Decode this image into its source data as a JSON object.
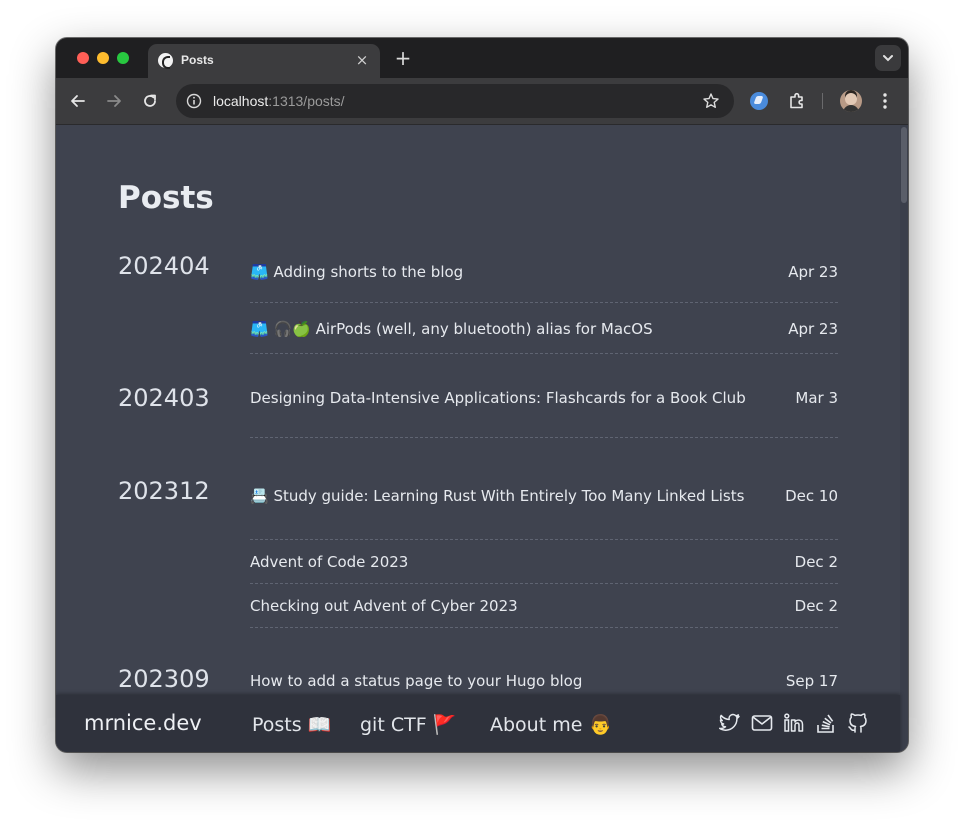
{
  "browser": {
    "tab_title": "Posts",
    "tab_close": "×",
    "new_tab": "+",
    "url_host": "localhost",
    "url_path": ":1313/posts/"
  },
  "page": {
    "title": "Posts",
    "groups": [
      {
        "year": "202404",
        "posts": [
          {
            "title": "🩳 Adding shorts to the blog",
            "date": "Apr 23"
          },
          {
            "title": "🩳 🎧🍏 AirPods (well, any bluetooth) alias for MacOS",
            "date": "Apr 23"
          }
        ]
      },
      {
        "year": "202403",
        "posts": [
          {
            "title": "Designing Data-Intensive Applications: Flashcards for a Book Club",
            "date": "Mar 3"
          }
        ]
      },
      {
        "year": "202312",
        "posts": [
          {
            "title": "📇 Study guide: Learning Rust With Entirely Too Many Linked Lists",
            "date": "Dec 10"
          },
          {
            "title": "Advent of Code 2023",
            "date": "Dec 2"
          },
          {
            "title": "Checking out Advent of Cyber 2023",
            "date": "Dec 2"
          }
        ]
      },
      {
        "year": "202309",
        "posts": [
          {
            "title": "How to add a status page to your Hugo blog",
            "date": "Sep 17"
          }
        ]
      }
    ]
  },
  "footer": {
    "brand": "mrnice.dev",
    "nav": {
      "posts": "Posts 📖",
      "ctf": "git CTF 🚩",
      "about": "About me 👨"
    },
    "social_icons": [
      "twitter-icon",
      "mail-icon",
      "linkedin-icon",
      "stackoverflow-icon",
      "github-icon"
    ]
  }
}
